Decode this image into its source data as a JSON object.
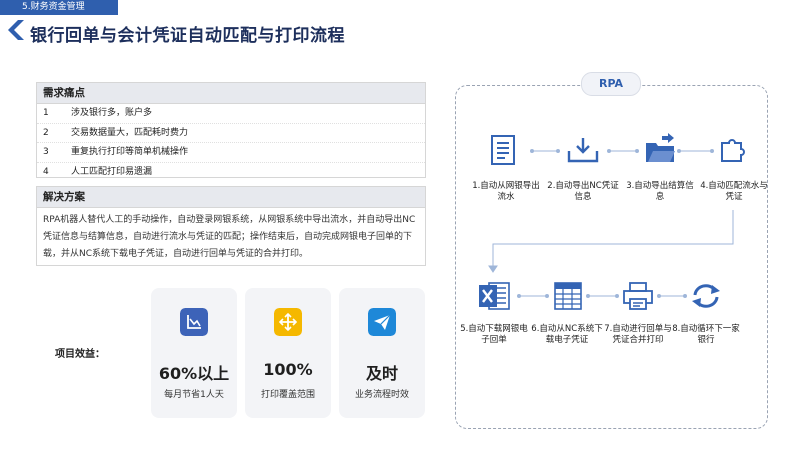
{
  "header": {
    "section_tag": "5.财务资金管理",
    "title": "银行回单与会计凭证自动匹配与打印流程"
  },
  "pain_points": {
    "heading": "需求痛点",
    "items": [
      {
        "num": "1",
        "text": "涉及银行多，账户多"
      },
      {
        "num": "2",
        "text": "交易数据量大，匹配耗时费力"
      },
      {
        "num": "3",
        "text": "重复执行打印等简单机械操作"
      },
      {
        "num": "4",
        "text": "人工匹配打印易遗漏"
      }
    ]
  },
  "solution": {
    "heading": "解决方案",
    "text": "RPA机器人替代人工的手动操作，自动登录网银系统，从网银系统中导出流水，并自动导出NC凭证信息与结算信息，自动进行流水与凭证的匹配；操作结束后，自动完成网银电子回单的下载，并从NC系统下载电子凭证，自动进行回单与凭证的合并打印。"
  },
  "benefits": {
    "label": "项目效益：",
    "cards": [
      {
        "icon": "chart-icon",
        "value": "60%以上",
        "caption": "每月节省1人天",
        "color": "#3d63b8"
      },
      {
        "icon": "expand-icon",
        "value": "100%",
        "caption": "打印覆盖范围",
        "color": "#f5b800"
      },
      {
        "icon": "send-icon",
        "value": "及时",
        "caption": "业务流程时效",
        "color": "#1e88d8"
      }
    ]
  },
  "rpa": {
    "badge": "RPA",
    "steps": [
      {
        "icon": "document-icon",
        "label": "1.自动从网银导出流水"
      },
      {
        "icon": "download-icon",
        "label": "2.自动导出NC凭证信息"
      },
      {
        "icon": "folder-open-icon",
        "label": "3.自动导出结算信息"
      },
      {
        "icon": "puzzle-icon",
        "label": "4.自动匹配流水与凭证"
      },
      {
        "icon": "excel-icon",
        "label": "5.自动下载网银电子回单"
      },
      {
        "icon": "spreadsheet-icon",
        "label": "6.自动从NC系统下载电子凭证"
      },
      {
        "icon": "printer-icon",
        "label": "7.自动进行回单与凭证合并打印"
      },
      {
        "icon": "refresh-icon",
        "label": "8.自动循环下一家银行"
      }
    ]
  }
}
